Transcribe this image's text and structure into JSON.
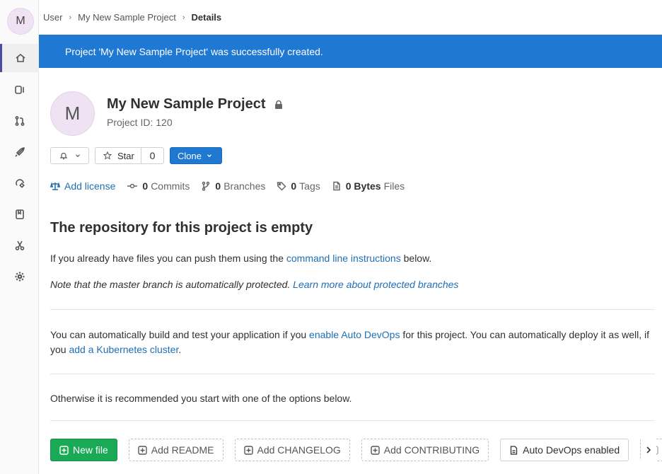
{
  "sidebar": {
    "avatar_letter": "M",
    "items": [
      {
        "icon": "home-icon",
        "active": true
      },
      {
        "icon": "issues-icon"
      },
      {
        "icon": "merge-request-icon"
      },
      {
        "icon": "rocket-icon"
      },
      {
        "icon": "operations-icon"
      },
      {
        "icon": "wiki-icon"
      },
      {
        "icon": "snippets-icon"
      },
      {
        "icon": "settings-icon"
      }
    ]
  },
  "breadcrumb": {
    "user": "User",
    "project": "My New Sample Project",
    "current": "Details"
  },
  "flash": {
    "message": "Project 'My New Sample Project' was successfully created."
  },
  "project": {
    "avatar_letter": "M",
    "name": "My New Sample Project",
    "id_label": "Project ID: 120",
    "star_label": "Star",
    "star_count": "0",
    "clone_label": "Clone"
  },
  "stats": {
    "add_license": "Add license",
    "commits_count": "0",
    "commits_label": "Commits",
    "branches_count": "0",
    "branches_label": "Branches",
    "tags_count": "0",
    "tags_label": "Tags",
    "files_size": "0 Bytes",
    "files_label": "Files"
  },
  "empty": {
    "title": "The repository for this project is empty",
    "push_text_before": "If you already have files you can push them using the ",
    "push_link": "command line instructions",
    "push_text_after": " below.",
    "note_text": "Note that the master branch is automatically protected. ",
    "note_link": "Learn more about protected branches",
    "devops_text_1": "You can automatically build and test your application if you ",
    "devops_link": "enable Auto DevOps",
    "devops_text_2": " for this project. You can automatically deploy it as well, if you ",
    "k8s_link": "add a Kubernetes cluster",
    "devops_text_3": ".",
    "otherwise": "Otherwise it is recommended you start with one of the options below."
  },
  "actions": {
    "new_file": "New file",
    "add_readme": "Add README",
    "add_changelog": "Add CHANGELOG",
    "add_contributing": "Add CONTRIBUTING",
    "auto_devops": "Auto DevOps enabled",
    "clipped": "A"
  },
  "colors": {
    "flash_bg": "#1f78d1",
    "link": "#1f6eb5",
    "new_file_green": "#1aaa55",
    "active_accent": "#4b4ba3"
  }
}
